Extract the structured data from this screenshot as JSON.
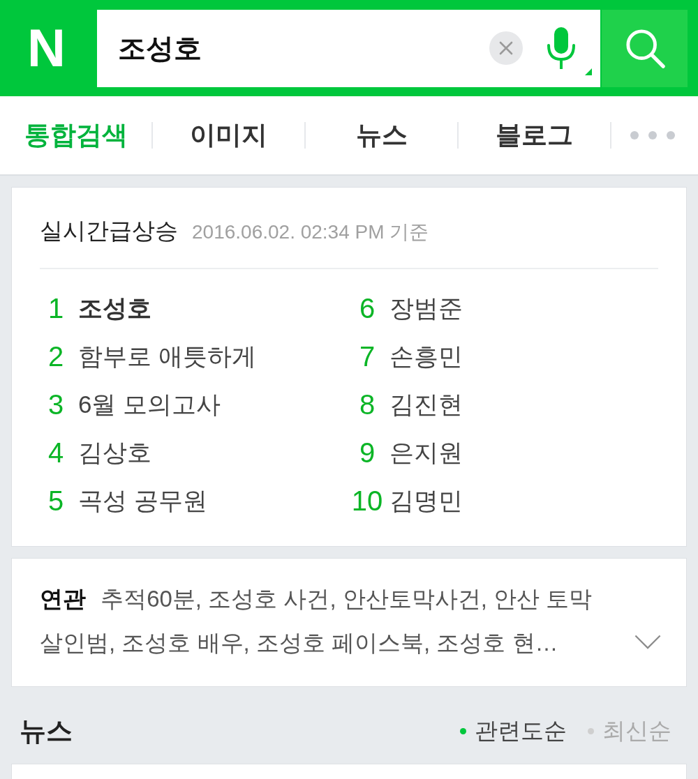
{
  "header": {
    "logo": "N",
    "search": {
      "value": "조성호"
    }
  },
  "tabs": [
    {
      "label": "통합검색",
      "selected": true
    },
    {
      "label": "이미지",
      "selected": false
    },
    {
      "label": "뉴스",
      "selected": false
    },
    {
      "label": "블로그",
      "selected": false
    }
  ],
  "trending": {
    "title": "실시간급상승",
    "timestamp": "2016.06.02. 02:34 PM 기준",
    "items": [
      {
        "rank": "1",
        "keyword": "조성호",
        "highlighted": true
      },
      {
        "rank": "2",
        "keyword": "함부로 애틋하게",
        "highlighted": false
      },
      {
        "rank": "3",
        "keyword": "6월 모의고사",
        "highlighted": false
      },
      {
        "rank": "4",
        "keyword": "김상호",
        "highlighted": false
      },
      {
        "rank": "5",
        "keyword": "곡성 공무원",
        "highlighted": false
      },
      {
        "rank": "6",
        "keyword": "장범준",
        "highlighted": false
      },
      {
        "rank": "7",
        "keyword": "손흥민",
        "highlighted": false
      },
      {
        "rank": "8",
        "keyword": "김진현",
        "highlighted": false
      },
      {
        "rank": "9",
        "keyword": "은지원",
        "highlighted": false
      },
      {
        "rank": "10",
        "keyword": "김명민",
        "highlighted": false
      }
    ]
  },
  "related": {
    "text": "**연관** 추적60분, 조성호 사건, 안산토막사건, 안산 토막 살인범, 조성호 배우, 조성호 페이스북, 조성호 현…"
  },
  "news": {
    "title": "뉴스",
    "sort_options": [
      {
        "label": "관련도순",
        "selected": true
      },
      {
        "label": "최신순",
        "selected": false
      }
    ]
  }
}
